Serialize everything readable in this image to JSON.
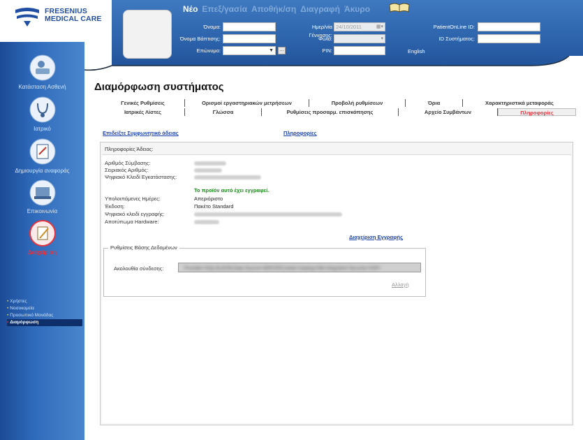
{
  "brand": {
    "name_line1": "FRESENIUS",
    "name_line2": "MEDICAL CARE"
  },
  "top_menu": {
    "new": "Νέο",
    "edit": "Επεξ/γασία",
    "save": "Αποθήκ/ση",
    "delete": "Διαγραφή",
    "cancel": "Άκυρο"
  },
  "patient_form": {
    "name_label": "Όνομα:",
    "name_value": "",
    "baptism_label": "Όνομα Βάπτισης:",
    "baptism_value": "",
    "surname_label": "Επώνυμο:",
    "surname_value": "",
    "dob_label": "Ημερ/νία Γέννησης:",
    "dob_value": "24/10/2011",
    "sex_label": "Φύλο:",
    "sex_value": "",
    "pin_label": "PIN:",
    "pin_value": "",
    "language": "English",
    "patient_online_label": "PatientOnLine ID:",
    "patient_online_value": "",
    "system_id_label": "ID Συστήματος:",
    "system_id_value": "",
    "more_button": "..."
  },
  "sidebar": {
    "items": [
      {
        "label": "Κατάσταση Ασθενή"
      },
      {
        "label": "Ιατρικό"
      },
      {
        "label": "Δημιουργία αναφοράς"
      },
      {
        "label": "Επικοινωνία"
      },
      {
        "label": "Διαχείριση"
      }
    ],
    "sub_items": [
      {
        "label": "Χρήστες"
      },
      {
        "label": "Νοσοκομεία"
      },
      {
        "label": "Προσωπικό Μονάδας"
      },
      {
        "label": "Διαμόρφωση"
      }
    ]
  },
  "page": {
    "title": "Διαμόρφωση συστήματος"
  },
  "tabs": {
    "row1": [
      "Γενικές Ρυθμίσεις",
      "Ορισμοί εργαστηριακών μετρήσεων",
      "Προβολή ρυθμίσεων",
      "Όρια",
      "Χαρακτηριστικά μεταφοράς"
    ],
    "row2": [
      "Ιατρικές Λίστες",
      "Γλώσσα",
      "Ρυθμίσεις προσαρμ. επισκόπησης",
      "Αρχείο Συμβάντων",
      "Πληροφορίες"
    ]
  },
  "links": {
    "license_agreement": "Επιδείξτε Συμφωνητικό άδειας",
    "info": "Πληροφορίες"
  },
  "license": {
    "panel_title": "Πληροφορίες Άδειας:",
    "contract_label": "Αριθμός Σύμβασης:",
    "serial_label": "Σειριακός Αριθμός:",
    "install_key_label": "Ψηφιακό Κλειδί Εγκατάστασης:",
    "registered_msg": "Το προϊόν αυτό έχει εγγραφεί.",
    "remaining_days_label": "Υπολοιπόμενες Ημέρες:",
    "remaining_days_value": "Απεριόριστο",
    "edition_label": "Έκδοση:",
    "edition_value": "Πακέτο Standard",
    "reg_key_label": "Ψηφιακό κλειδί εγγραφής:",
    "hardware_label": "Αποτύπωμα Hardware:",
    "manage_registration": "Διαχείριση Εγγραφής"
  },
  "database": {
    "legend": "Ρυθμίσεις Βάσης Δεδομένων",
    "conn_label": "Ακολουθία σύνδεσης:",
    "conn_value": "Provider=SQLOLEDB;Data Source=SERVER;Initial Catalog=DB;Integrated Security=SSPI",
    "change": "Αλλαγή"
  },
  "colors": {
    "header_blue": "#2c63ab",
    "active_red": "#e8323c",
    "link_blue": "#1a3fa8",
    "ok_green": "#178a17"
  }
}
